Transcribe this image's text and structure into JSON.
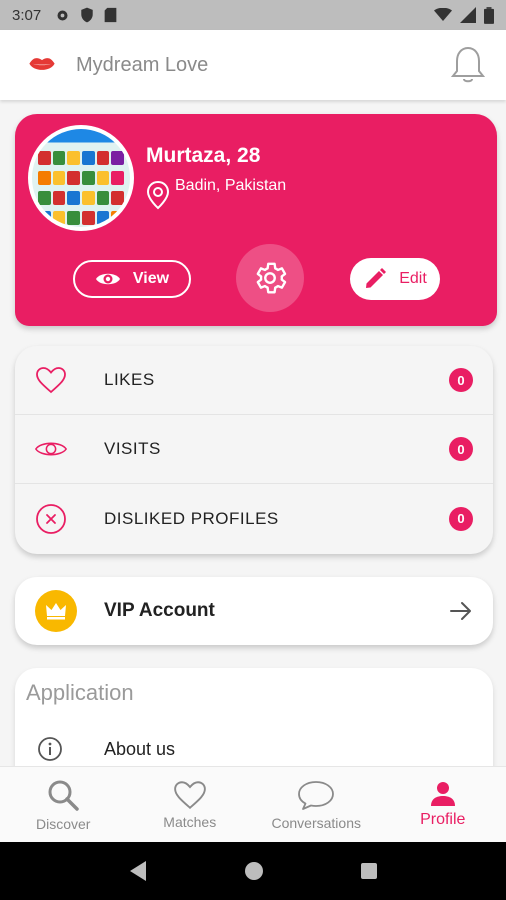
{
  "status_bar": {
    "time": "3:07"
  },
  "app_bar": {
    "title": "Mydream Love"
  },
  "profile": {
    "name": "Murtaza, 28",
    "location": "Badin, Pakistan",
    "view_label": "View",
    "edit_label": "Edit"
  },
  "stats": [
    {
      "label": "LIKES",
      "count": "0"
    },
    {
      "label": "VISITS",
      "count": "0"
    },
    {
      "label": "DISLIKED PROFILES",
      "count": "0"
    }
  ],
  "vip": {
    "label": "VIP Account"
  },
  "application": {
    "title": "Application",
    "about_label": "About us"
  },
  "bottom_nav": [
    {
      "label": "Discover",
      "icon": "search-icon"
    },
    {
      "label": "Matches",
      "icon": "heart-icon"
    },
    {
      "label": "Conversations",
      "icon": "chat-bubble-icon"
    },
    {
      "label": "Profile",
      "icon": "person-icon",
      "active": true
    }
  ],
  "colors": {
    "accent": "#e91e63",
    "vip": "#f9b800"
  }
}
